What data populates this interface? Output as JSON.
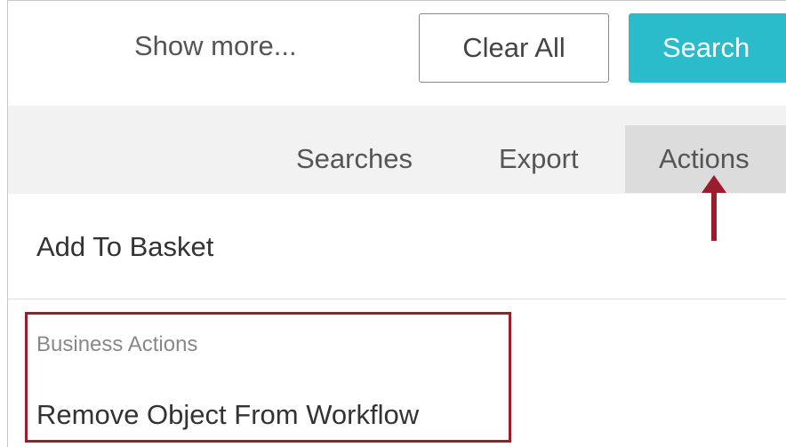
{
  "toolbar": {
    "show_more_label": "Show more...",
    "clear_all_label": "Clear All",
    "search_label": "Search"
  },
  "tabs": [
    {
      "label": "Searches"
    },
    {
      "label": "Export"
    },
    {
      "label": "Actions",
      "active": true
    }
  ],
  "actions_menu": {
    "add_to_basket_label": "Add To Basket",
    "business_actions_heading": "Business Actions",
    "remove_object_label": "Remove Object From Workflow"
  },
  "colors": {
    "search_button": "#2bbccc",
    "annotation": "#9b1c2c",
    "tab_bar": "#f2f2f2",
    "active_tab": "#dcdcdc"
  },
  "icons": {
    "pointer": "arrow-up-icon"
  }
}
